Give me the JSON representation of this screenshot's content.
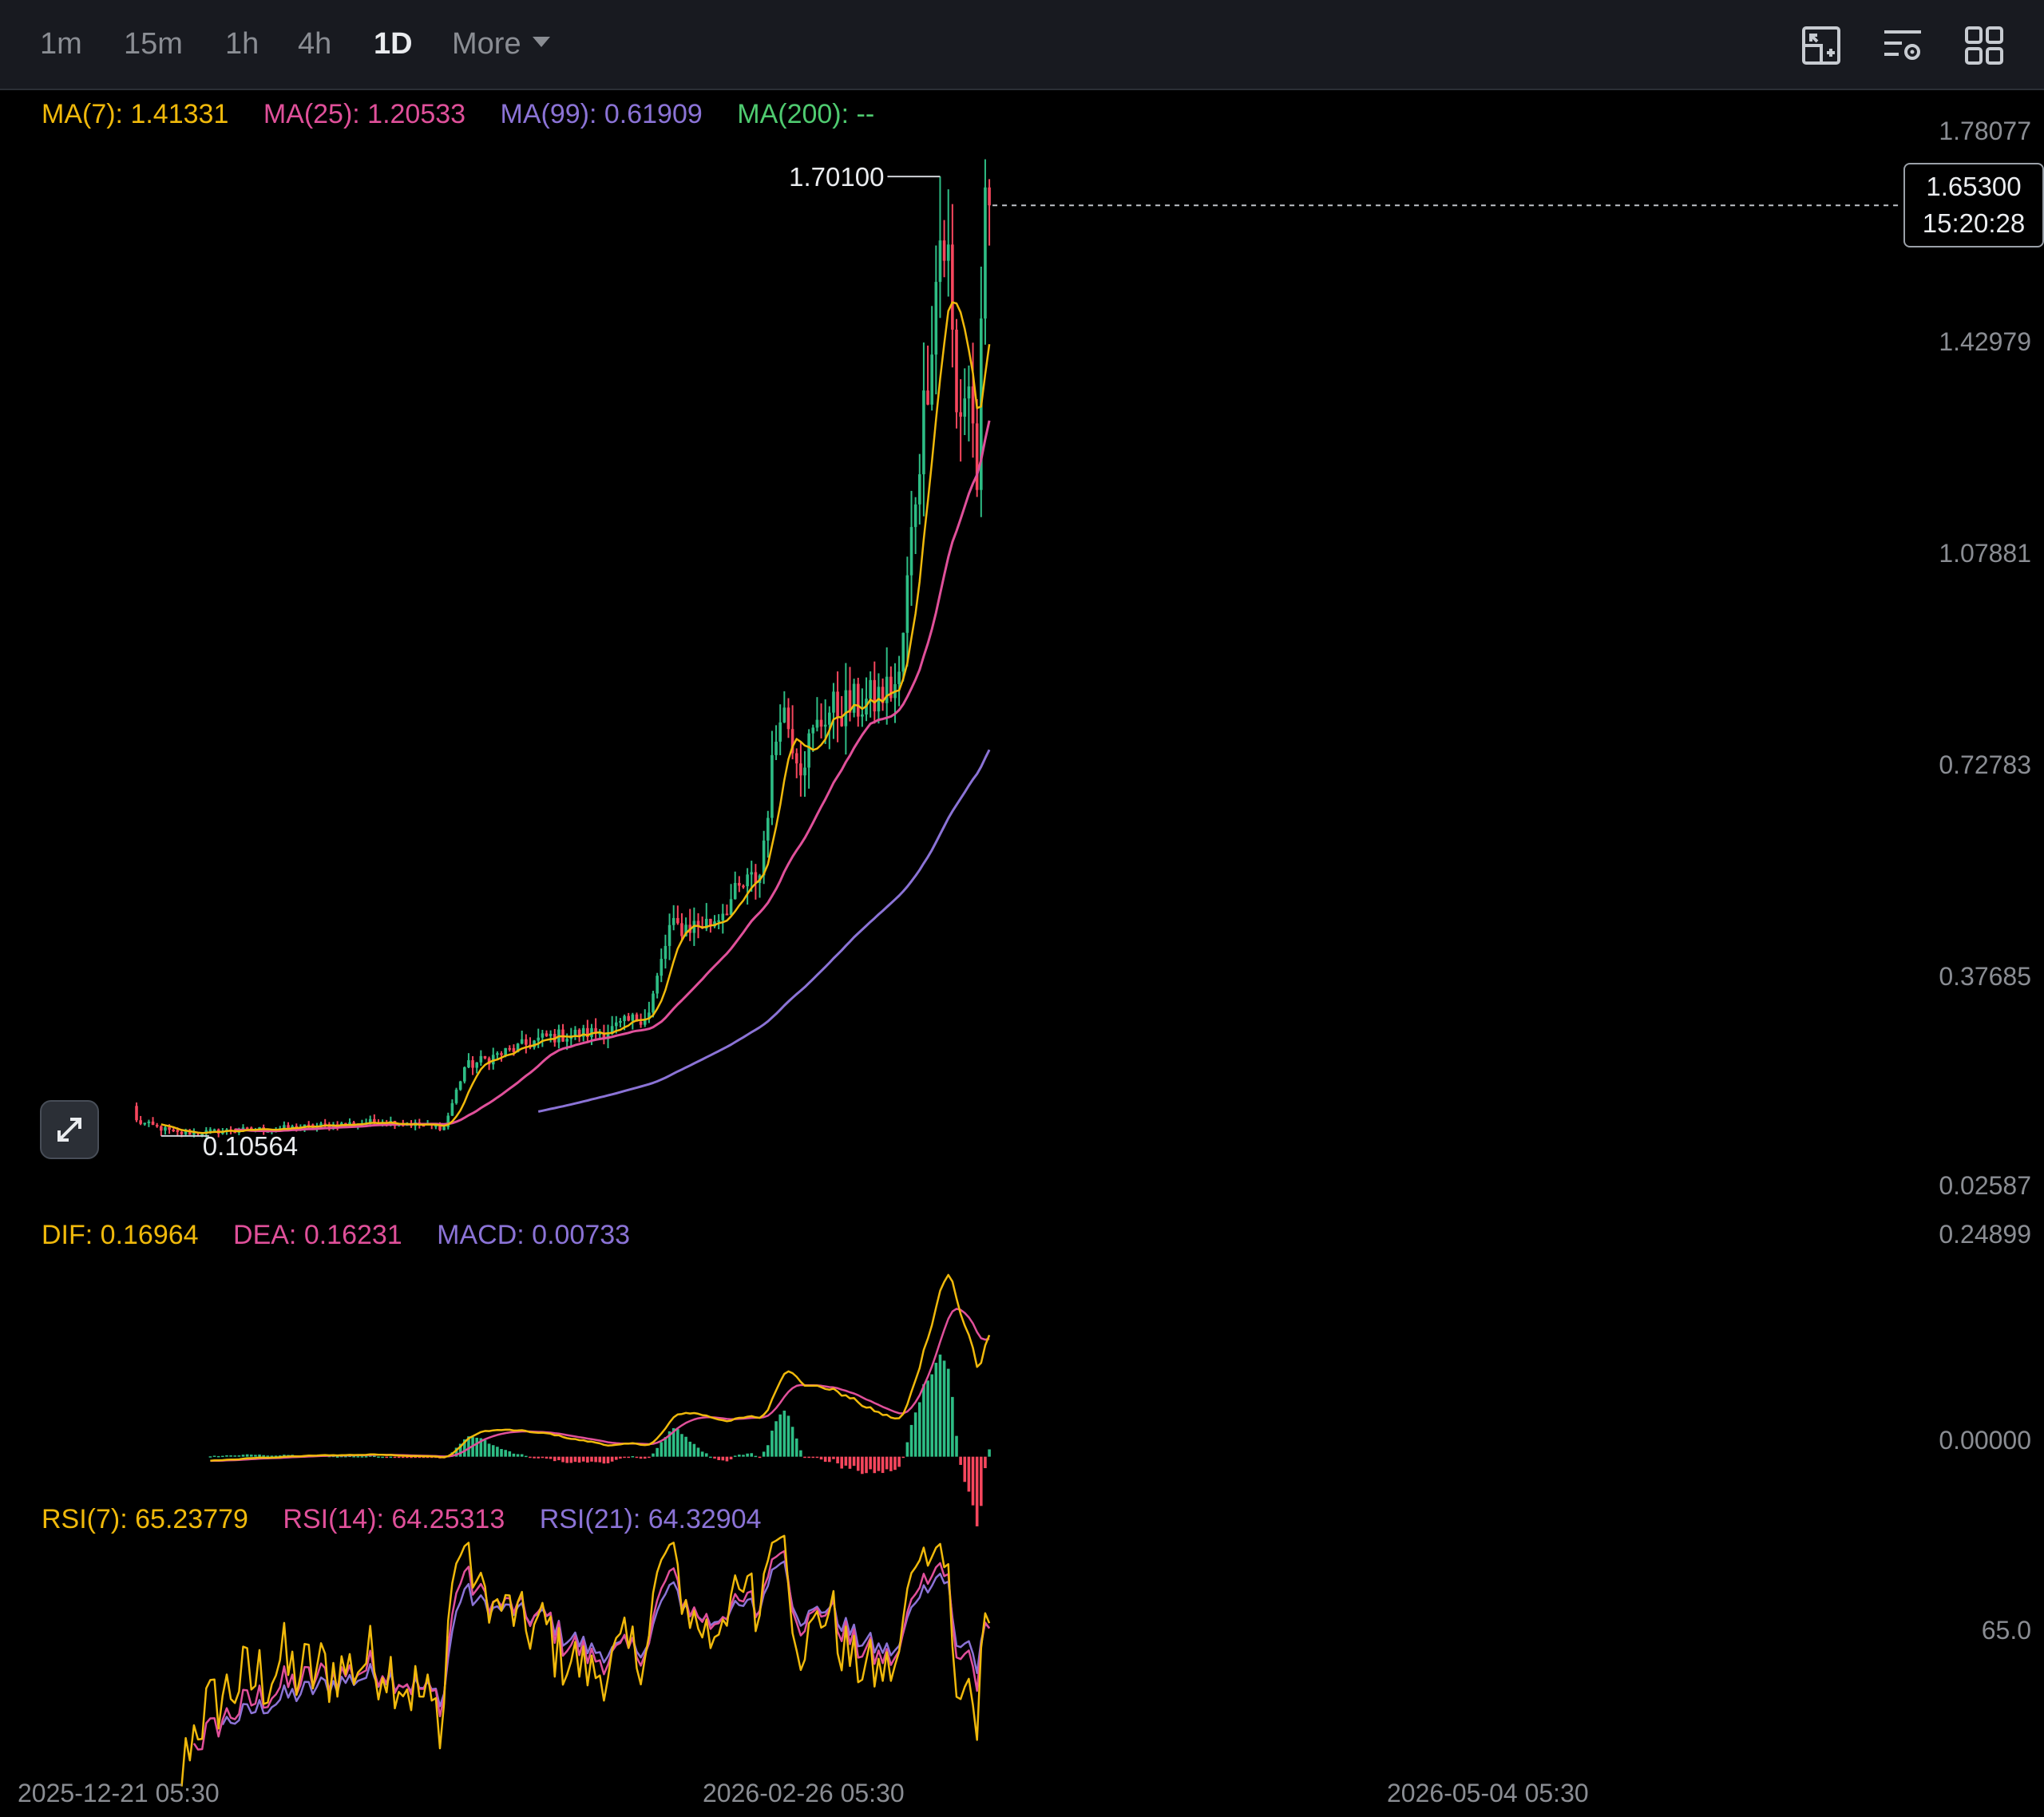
{
  "toolbar": {
    "timeframes": [
      "1m",
      "15m",
      "1h",
      "4h",
      "1D"
    ],
    "active_timeframe": "1D",
    "more_label": "More",
    "icons": [
      "chart-layout-icon",
      "indicator-settings-icon",
      "grid-layout-icon"
    ]
  },
  "legends": {
    "ma": [
      {
        "label": "MA(7): 1.41331",
        "color": "#f0b90b"
      },
      {
        "label": "MA(25): 1.20533",
        "color": "#e0509a"
      },
      {
        "label": "MA(99): 0.61909",
        "color": "#8b73d6"
      },
      {
        "label": "MA(200): --",
        "color": "#4fcb70"
      }
    ],
    "macd": [
      {
        "label": "DIF: 0.16964",
        "color": "#f0b90b"
      },
      {
        "label": "DEA: 0.16231",
        "color": "#e0509a"
      },
      {
        "label": "MACD: 0.00733",
        "color": "#8b73d6"
      }
    ],
    "rsi": [
      {
        "label": "RSI(7): 65.23779",
        "color": "#f0b90b"
      },
      {
        "label": "RSI(14): 64.25313",
        "color": "#e0509a"
      },
      {
        "label": "RSI(21): 64.32904",
        "color": "#8b73d6"
      }
    ]
  },
  "price_axis": [
    "1.78077",
    "1.42979",
    "1.07881",
    "0.72783",
    "0.37685",
    "0.02587"
  ],
  "macd_axis": [
    "0.24899",
    "0.00000"
  ],
  "rsi_axis": [
    "65.0"
  ],
  "current_price": {
    "price": "1.65300",
    "countdown": "15:20:28"
  },
  "high_label": "1.70100",
  "low_label": "0.10564",
  "dates": [
    "2025-12-21 05:30",
    "2026-02-26 05:30",
    "2026-05-04 05:30"
  ],
  "colors": {
    "up": "#2ebd85",
    "down": "#f6465d",
    "ma7": "#f0b90b",
    "ma25": "#e0509a",
    "ma99": "#8b73d6"
  },
  "chart_data": {
    "type": "candlestick",
    "interval": "1D",
    "price_ylim": [
      0.02587,
      1.78077
    ],
    "macd_ylim": [
      -0.05,
      0.25
    ],
    "rsi_ylim": [
      25,
      100
    ],
    "key_points": [
      {
        "day": 0,
        "price": 0.13
      },
      {
        "day": 10,
        "price": 0.11
      },
      {
        "day": 40,
        "price": 0.12
      },
      {
        "day": 60,
        "price": 0.13
      },
      {
        "day": 75,
        "price": 0.12
      },
      {
        "day": 80,
        "price": 0.22
      },
      {
        "day": 100,
        "price": 0.27
      },
      {
        "day": 115,
        "price": 0.28
      },
      {
        "day": 125,
        "price": 0.31
      },
      {
        "day": 130,
        "price": 0.45
      },
      {
        "day": 140,
        "price": 0.46
      },
      {
        "day": 148,
        "price": 0.52
      },
      {
        "day": 152,
        "price": 0.54
      },
      {
        "day": 157,
        "price": 0.83
      },
      {
        "day": 162,
        "price": 0.73
      },
      {
        "day": 168,
        "price": 0.81
      },
      {
        "day": 180,
        "price": 0.83
      },
      {
        "day": 186,
        "price": 0.86
      },
      {
        "day": 190,
        "price": 1.18
      },
      {
        "day": 193,
        "price": 1.38
      },
      {
        "day": 196,
        "price": 1.6
      },
      {
        "day": 198,
        "price": 1.56
      },
      {
        "day": 200,
        "price": 1.3
      },
      {
        "day": 203,
        "price": 1.36
      },
      {
        "day": 205,
        "price": 1.2
      },
      {
        "day": 207,
        "price": 1.62
      },
      {
        "day": 208,
        "price": 1.653
      }
    ],
    "high": 1.701,
    "low": 0.10564,
    "ma7_last": 1.41331,
    "ma25_last": 1.20533,
    "ma99_last": 0.61909,
    "dif_last": 0.16964,
    "dea_last": 0.16231,
    "macd_last": 0.00733,
    "rsi7_last": 65.23779,
    "rsi14_last": 64.25313,
    "rsi21_last": 64.32904
  }
}
